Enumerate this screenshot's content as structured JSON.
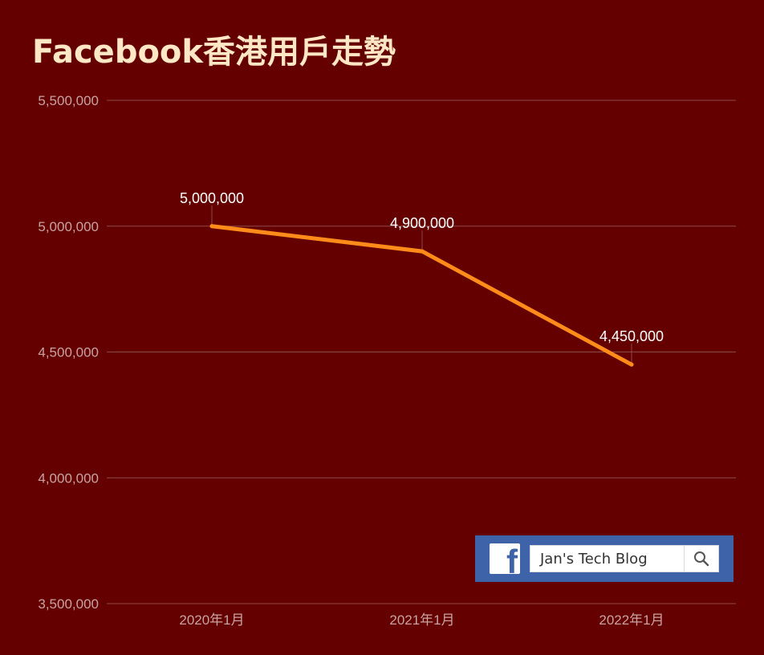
{
  "chart_data": {
    "type": "line",
    "title": "Facebook香港用戶走勢",
    "categories": [
      "2020年1月",
      "2021年1月",
      "2022年1月"
    ],
    "series": [
      {
        "values": [
          5000000,
          4900000,
          4450000
        ],
        "color": "#ff8c1a"
      }
    ],
    "data_labels": [
      "5,000,000",
      "4,900,000",
      "4,450,000"
    ],
    "y_ticks": [
      3500000,
      4000000,
      4500000,
      5000000,
      5500000
    ],
    "y_tick_labels": [
      "3,500,000",
      "4,000,000",
      "4,500,000",
      "5,000,000",
      "5,500,000"
    ],
    "ylim": [
      3500000,
      5500000
    ],
    "grid": true,
    "xlabel": "",
    "ylabel": "",
    "colors": {
      "background": "#650000",
      "title": "#fde7c4",
      "line": "#ff8c1a"
    }
  },
  "banner": {
    "icon": "facebook-icon",
    "search_text": "Jan's Tech Blog",
    "search_icon": "search-icon",
    "color": "#3f63a8"
  }
}
